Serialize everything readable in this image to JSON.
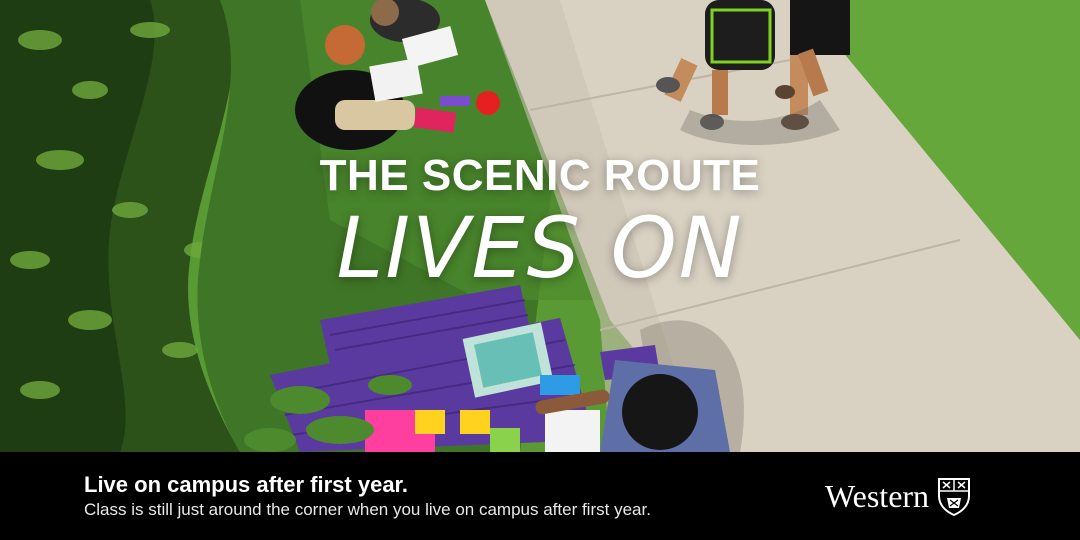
{
  "headline": {
    "line1": "THE SCENIC ROUTE",
    "line2": "LIVES ON"
  },
  "footer": {
    "title": "Live on campus after first year.",
    "subtitle": "Class is still just around the corner when you live on campus after first year."
  },
  "logo": {
    "wordmark": "Western",
    "crest_icon": "shield-crest-icon"
  },
  "colors": {
    "grass": "#5a9a34",
    "shadow_grass": "#2f5a1c",
    "sidewalk": "#d9d2c3",
    "bench_purple": "#5b3aa0",
    "footer_bg": "#000000",
    "text": "#ffffff"
  }
}
